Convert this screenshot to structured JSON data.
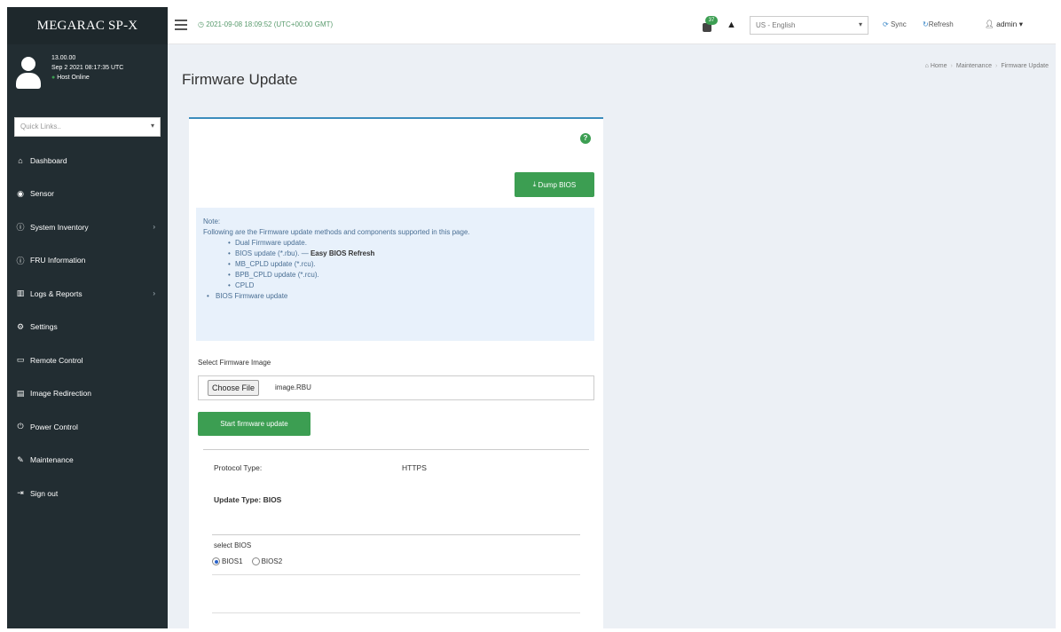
{
  "sidebar": {
    "brand": "MEGARAC SP-X",
    "user": {
      "version": "13.00.00",
      "datetime": "Sep 2 2021 08:17:35 UTC",
      "status": "Host Online"
    },
    "quicklinks_placeholder": "Quick Links..",
    "items": [
      {
        "label": "Dashboard",
        "icon": "home-icon"
      },
      {
        "label": "Sensor",
        "icon": "sensor-icon"
      },
      {
        "label": "System Inventory",
        "icon": "info-icon"
      },
      {
        "label": "FRU Information",
        "icon": "info-icon"
      },
      {
        "label": "Logs & Reports",
        "icon": "chart-icon"
      },
      {
        "label": "Settings",
        "icon": "gear-icon"
      },
      {
        "label": "Remote Control",
        "icon": "monitor-icon"
      },
      {
        "label": "Image Redirection",
        "icon": "media-icon"
      },
      {
        "label": "Power Control",
        "icon": "power-icon"
      },
      {
        "label": "Maintenance",
        "icon": "wrench-icon"
      },
      {
        "label": "Sign out",
        "icon": "sign-out-icon"
      }
    ]
  },
  "topbar": {
    "datetime": "2021-09-08 18:09:52 (UTC+00:00 GMT)",
    "notification_count": "37",
    "language": "US - English",
    "sync_label": "Sync",
    "refresh_label": "Refresh",
    "user_label": "admin"
  },
  "page": {
    "title": "Firmware Update",
    "breadcrumb": [
      "Home",
      "Maintenance",
      "Firmware Update"
    ]
  },
  "box": {
    "dump_button": "Dump BIOS",
    "note": {
      "label": "Note:",
      "intro": "Following are the Firmware update methods and components supported in this page.",
      "sub_items": [
        "Dual Firmware update.",
        "BIOS update (*.rbu).",
        "MB_CPLD update (*.rcu).",
        "BPB_CPLD update (*.rcu).",
        "CPLD"
      ],
      "bios_suffix": " — ",
      "bios_bold": "Easy BIOS Refresh",
      "top_item": "BIOS Firmware update"
    },
    "select_label": "Select Firmware Image",
    "choose_button": "Choose File",
    "file_name": "image.RBU",
    "start_button": "Start firmware update",
    "protocol_label": "Protocol Type:",
    "protocol_value": "HTTPS",
    "update_type": "Update Type: BIOS",
    "select_bios_label": "select BIOS",
    "bios_options": [
      "BIOS1",
      "BIOS2"
    ],
    "bios_selected": "BIOS1"
  },
  "colors": {
    "sidebar_bg": "#222d32",
    "accent_green": "#3c9e52",
    "accent_blue": "#3c8dbc",
    "note_bg": "#e8f1fb"
  }
}
